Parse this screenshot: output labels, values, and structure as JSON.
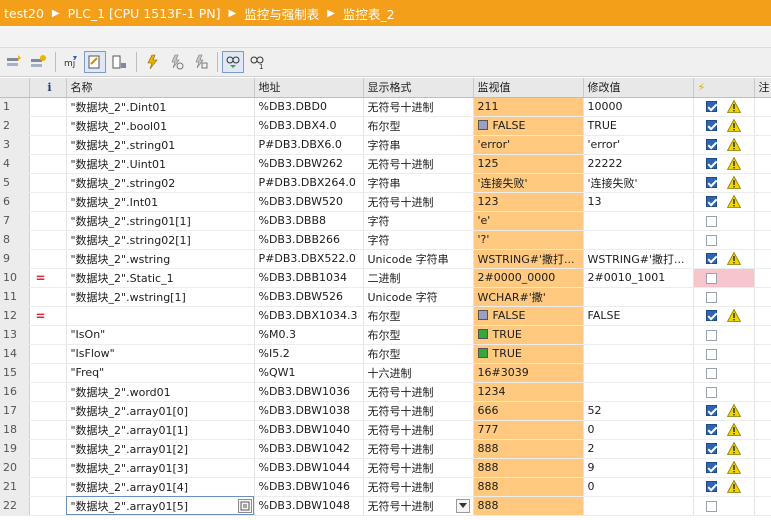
{
  "breadcrumb": {
    "project": "test20",
    "device": "PLC_1 [CPU 1513F-1 PN]",
    "folder": "监控与强制表",
    "table": "监控表_2"
  },
  "toolbar": {
    "buttons": [
      {
        "name": "insert-row-icon",
        "active": false
      },
      {
        "name": "add-row-icon",
        "active": false
      },
      {
        "name": "show-all-modify-icon",
        "active": false
      },
      {
        "name": "show-monitor-icon",
        "active": true
      },
      {
        "name": "trigger-settings-icon",
        "active": false
      },
      {
        "name": "modify-now-icon",
        "active": false
      },
      {
        "name": "modify-with-trigger-icon",
        "active": false
      },
      {
        "name": "enable-peripheral-icon",
        "active": false
      },
      {
        "name": "monitor-all-icon",
        "active": true
      },
      {
        "name": "monitor-once-icon",
        "active": false
      }
    ]
  },
  "columns": {
    "num": "",
    "info": "i",
    "name": "名称",
    "address": "地址",
    "format": "显示格式",
    "monitor": "监视值",
    "modify": "修改值",
    "trigger": "⚡",
    "comment": "注"
  },
  "rows": [
    {
      "n": "1",
      "mark": "",
      "name": "\"数据块_2\".Dint01",
      "addr": "%DB3.DBD0",
      "fmt": "无符号十进制",
      "mon": "211",
      "mod": "10000",
      "bool": "",
      "chk": true,
      "warn": true,
      "pink": false
    },
    {
      "n": "2",
      "mark": "",
      "name": "\"数据块_2\".bool01",
      "addr": "%DB3.DBX4.0",
      "fmt": "布尔型",
      "mon": "FALSE",
      "mod": "TRUE",
      "bool": "false",
      "chk": true,
      "warn": true,
      "pink": false
    },
    {
      "n": "3",
      "mark": "",
      "name": "\"数据块_2\".string01",
      "addr": "P#DB3.DBX6.0",
      "fmt": "字符串",
      "mon": "'error'",
      "mod": "'error'",
      "bool": "",
      "chk": true,
      "warn": true,
      "pink": false
    },
    {
      "n": "4",
      "mark": "",
      "name": "\"数据块_2\".Uint01",
      "addr": "%DB3.DBW262",
      "fmt": "无符号十进制",
      "mon": "125",
      "mod": "22222",
      "bool": "",
      "chk": true,
      "warn": true,
      "pink": false
    },
    {
      "n": "5",
      "mark": "",
      "name": "\"数据块_2\".string02",
      "addr": "P#DB3.DBX264.0",
      "fmt": "字符串",
      "mon": "'连接失败'",
      "mod": "'连接失败'",
      "bool": "",
      "chk": true,
      "warn": true,
      "pink": false
    },
    {
      "n": "6",
      "mark": "",
      "name": "\"数据块_2\".Int01",
      "addr": "%DB3.DBW520",
      "fmt": "无符号十进制",
      "mon": "123",
      "mod": "13",
      "bool": "",
      "chk": true,
      "warn": true,
      "pink": false
    },
    {
      "n": "7",
      "mark": "",
      "name": "\"数据块_2\".string01[1]",
      "addr": "%DB3.DBB8",
      "fmt": "字符",
      "mon": "'e'",
      "mod": "",
      "bool": "",
      "chk": false,
      "warn": false,
      "pink": false
    },
    {
      "n": "8",
      "mark": "",
      "name": "\"数据块_2\".string02[1]",
      "addr": "%DB3.DBB266",
      "fmt": "字符",
      "mon": "'?'",
      "mod": "",
      "bool": "",
      "chk": false,
      "warn": false,
      "pink": false
    },
    {
      "n": "9",
      "mark": "",
      "name": "\"数据块_2\".wstring",
      "addr": "P#DB3.DBX522.0",
      "fmt": "Unicode 字符串",
      "mon": "WSTRING#'撒打...",
      "mod": "WSTRING#'撒打...",
      "bool": "",
      "chk": true,
      "warn": true,
      "pink": false
    },
    {
      "n": "10",
      "mark": "=",
      "name": "\"数据块_2\".Static_1",
      "addr": "%DB3.DBB1034",
      "fmt": "二进制",
      "mon": "2#0000_0000",
      "mod": "2#0010_1001",
      "bool": "",
      "chk": false,
      "warn": false,
      "pink": true
    },
    {
      "n": "11",
      "mark": "",
      "name": "\"数据块_2\".wstring[1]",
      "addr": "%DB3.DBW526",
      "fmt": "Unicode 字符",
      "mon": "WCHAR#'撒'",
      "mod": "",
      "bool": "",
      "chk": false,
      "warn": false,
      "pink": false
    },
    {
      "n": "12",
      "mark": "=",
      "name": "",
      "addr": "%DB3.DBX1034.3",
      "fmt": "布尔型",
      "mon": "FALSE",
      "mod": "FALSE",
      "bool": "false",
      "chk": true,
      "warn": true,
      "pink": false
    },
    {
      "n": "13",
      "mark": "",
      "name": "\"IsOn\"",
      "addr": "%M0.3",
      "fmt": "布尔型",
      "mon": "TRUE",
      "mod": "",
      "bool": "true",
      "chk": false,
      "warn": false,
      "pink": false
    },
    {
      "n": "14",
      "mark": "",
      "name": "\"IsFlow\"",
      "addr": "%I5.2",
      "fmt": "布尔型",
      "mon": "TRUE",
      "mod": "",
      "bool": "true",
      "chk": false,
      "warn": false,
      "pink": false
    },
    {
      "n": "15",
      "mark": "",
      "name": "\"Freq\"",
      "addr": "%QW1",
      "fmt": "十六进制",
      "mon": "16#3039",
      "mod": "",
      "bool": "",
      "chk": false,
      "warn": false,
      "pink": false
    },
    {
      "n": "16",
      "mark": "",
      "name": "\"数据块_2\".word01",
      "addr": "%DB3.DBW1036",
      "fmt": "无符号十进制",
      "mon": "1234",
      "mod": "",
      "bool": "",
      "chk": false,
      "warn": false,
      "pink": false
    },
    {
      "n": "17",
      "mark": "",
      "name": "\"数据块_2\".array01[0]",
      "addr": "%DB3.DBW1038",
      "fmt": "无符号十进制",
      "mon": "666",
      "mod": "52",
      "bool": "",
      "chk": true,
      "warn": true,
      "pink": false
    },
    {
      "n": "18",
      "mark": "",
      "name": "\"数据块_2\".array01[1]",
      "addr": "%DB3.DBW1040",
      "fmt": "无符号十进制",
      "mon": "777",
      "mod": "0",
      "bool": "",
      "chk": true,
      "warn": true,
      "pink": false
    },
    {
      "n": "19",
      "mark": "",
      "name": "\"数据块_2\".array01[2]",
      "addr": "%DB3.DBW1042",
      "fmt": "无符号十进制",
      "mon": "888",
      "mod": "2",
      "bool": "",
      "chk": true,
      "warn": true,
      "pink": false
    },
    {
      "n": "20",
      "mark": "",
      "name": "\"数据块_2\".array01[3]",
      "addr": "%DB3.DBW1044",
      "fmt": "无符号十进制",
      "mon": "888",
      "mod": "9",
      "bool": "",
      "chk": true,
      "warn": true,
      "pink": false
    },
    {
      "n": "21",
      "mark": "",
      "name": "\"数据块_2\".array01[4]",
      "addr": "%DB3.DBW1046",
      "fmt": "无符号十进制",
      "mon": "888",
      "mod": "0",
      "bool": "",
      "chk": true,
      "warn": true,
      "pink": false
    },
    {
      "n": "22",
      "mark": "",
      "name": "\"数据块_2\".array01[5]",
      "addr": "%DB3.DBW1048",
      "fmt": "无符号十进制",
      "mon": "888",
      "mod": "",
      "bool": "",
      "chk": false,
      "warn": false,
      "pink": false,
      "selected": true
    }
  ],
  "colors": {
    "title_bg": "#f49f1a",
    "monitor_bg": "#ffca7f",
    "checkbox_on": "#2d64b4",
    "warning": "#f2d500",
    "pink_cell": "#f7c6cc"
  }
}
